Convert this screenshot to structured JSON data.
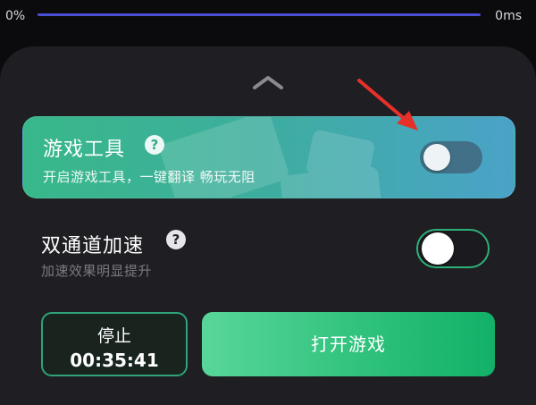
{
  "latency": {
    "left_label": "0%",
    "right_label": "0ms"
  },
  "game_tool": {
    "title": "游戏工具",
    "help_glyph": "?",
    "subtitle": "开启游戏工具，一键翻译 畅玩无阻",
    "toggle_on": false
  },
  "dual_channel": {
    "title": "双通道加速",
    "help_glyph": "?",
    "subtitle": "加速效果明显提升",
    "toggle_on": false
  },
  "stop_button": {
    "label": "停止",
    "timer": "00:35:41"
  },
  "open_button": {
    "label": "打开游戏"
  },
  "colors": {
    "accent_green": "#2fb079",
    "progress_blue": "#4b4fd6",
    "arrow_red": "#e8302a",
    "panel_bg": "#1e1e23"
  },
  "icons": {
    "handle": "chevron-up-icon",
    "help": "question-circle-icon",
    "arrow": "annotation-arrow-icon"
  }
}
